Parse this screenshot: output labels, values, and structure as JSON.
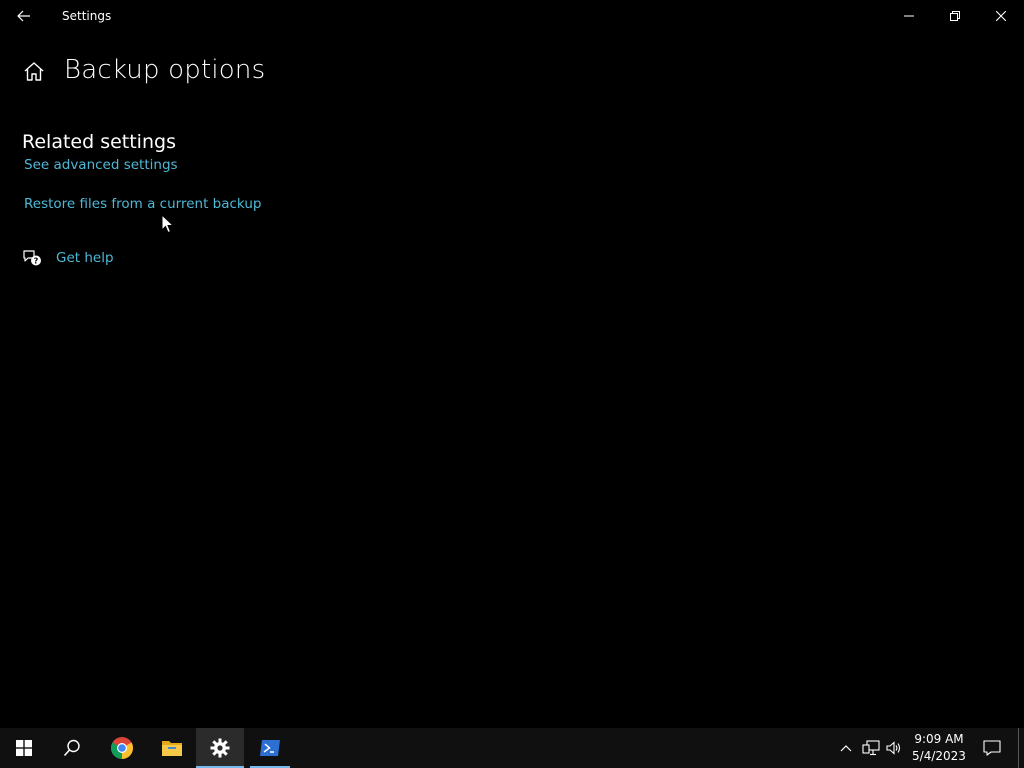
{
  "window": {
    "title": "Settings"
  },
  "header": {
    "page_title": "Backup options"
  },
  "related": {
    "heading": "Related settings",
    "links": [
      "See advanced settings",
      "Restore files from a current backup"
    ]
  },
  "help": {
    "label": "Get help"
  },
  "taskbar": {
    "apps": [
      "start-icon",
      "search-icon",
      "chrome-icon",
      "file-explorer-icon",
      "settings-icon",
      "powershell-icon"
    ],
    "active_app": "settings-icon"
  },
  "tray": {
    "time": "9:09 AM",
    "date": "5/4/2023"
  },
  "colors": {
    "background": "#000000",
    "link": "#4fb8d6",
    "taskbar": "#101010",
    "accent": "#76b9ed"
  }
}
